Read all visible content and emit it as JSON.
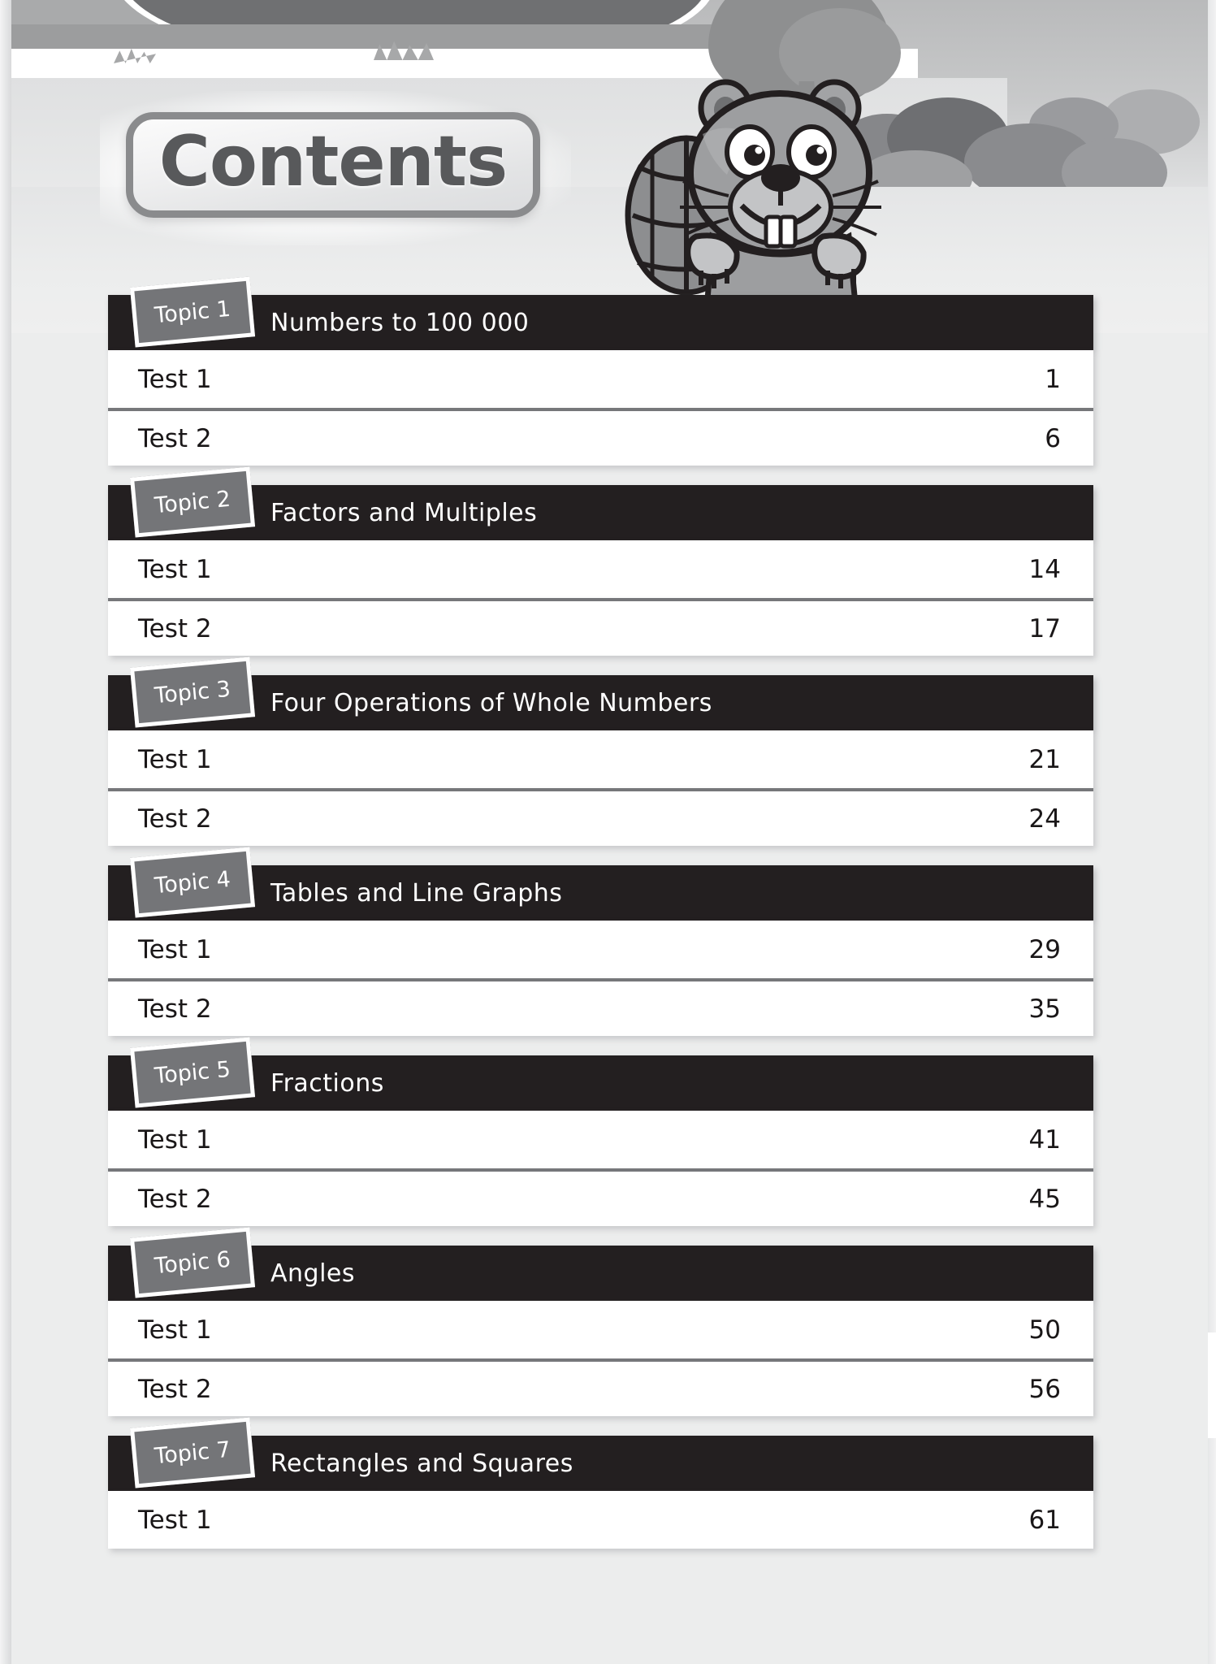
{
  "page": {
    "title": "Contents"
  },
  "colors": {
    "header_bar": "#231f20",
    "topic_tab": "#747578",
    "row_background": "#ffffff",
    "row_divider": "#76777a",
    "title_text": "#58595b",
    "page_background": "#eceded"
  },
  "labels": {
    "test_1": "Test 1",
    "test_2": "Test 2"
  },
  "topics": [
    {
      "tab": "Topic 1",
      "title": "Numbers to 100 000",
      "tests": [
        {
          "label": "Test 1",
          "page": "1"
        },
        {
          "label": "Test 2",
          "page": "6"
        }
      ]
    },
    {
      "tab": "Topic 2",
      "title": "Factors and Multiples",
      "tests": [
        {
          "label": "Test 1",
          "page": "14"
        },
        {
          "label": "Test 2",
          "page": "17"
        }
      ]
    },
    {
      "tab": "Topic 3",
      "title": "Four Operations of Whole Numbers",
      "tests": [
        {
          "label": "Test 1",
          "page": "21"
        },
        {
          "label": "Test 2",
          "page": "24"
        }
      ]
    },
    {
      "tab": "Topic 4",
      "title": "Tables and Line Graphs",
      "tests": [
        {
          "label": "Test 1",
          "page": "29"
        },
        {
          "label": "Test 2",
          "page": "35"
        }
      ]
    },
    {
      "tab": "Topic 5",
      "title": "Fractions",
      "tests": [
        {
          "label": "Test 1",
          "page": "41"
        },
        {
          "label": "Test 2",
          "page": "45"
        }
      ]
    },
    {
      "tab": "Topic 6",
      "title": "Angles",
      "tests": [
        {
          "label": "Test 1",
          "page": "50"
        },
        {
          "label": "Test 2",
          "page": "56"
        }
      ]
    },
    {
      "tab": "Topic 7",
      "title": "Rectangles and Squares",
      "tests": [
        {
          "label": "Test 1",
          "page": "61"
        }
      ]
    }
  ],
  "illustration": {
    "mascot": "beaver-illustration",
    "scenery": [
      "tree-silhouette",
      "bush-silhouette",
      "pond-silhouette",
      "grass-tufts"
    ]
  }
}
